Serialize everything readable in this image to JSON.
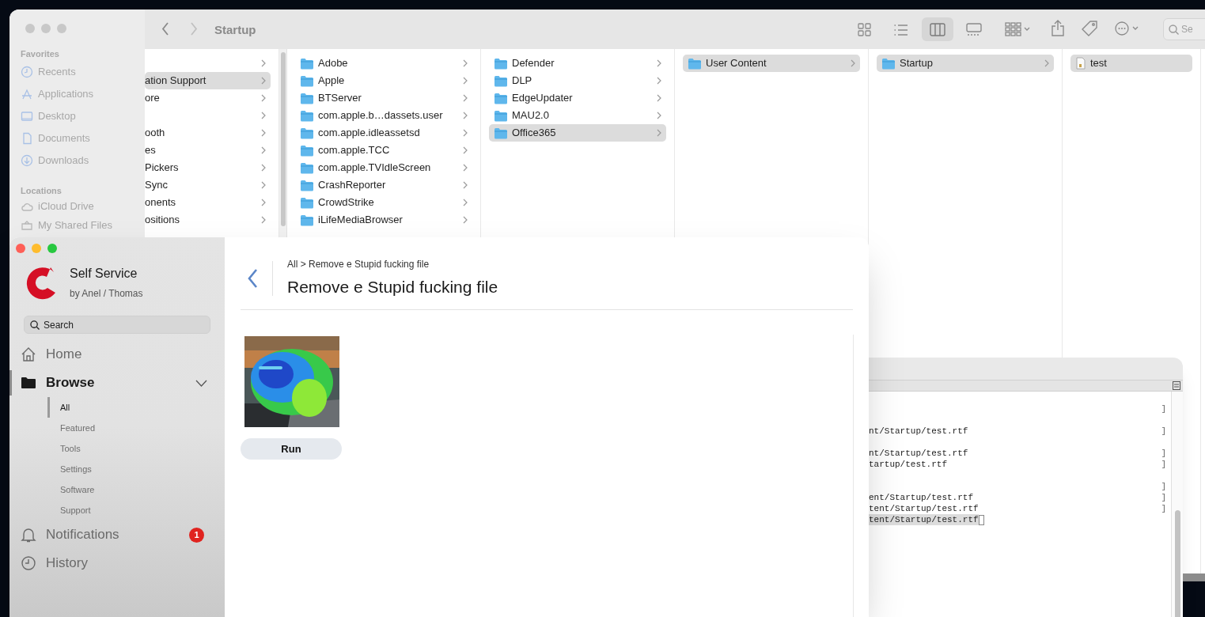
{
  "finder": {
    "title": "Startup",
    "search": {
      "placeholder": "Se"
    },
    "sidebar": [
      {
        "heading": "Favorites",
        "items": [
          {
            "label": "Recents"
          },
          {
            "label": "Applications"
          },
          {
            "label": "Desktop"
          },
          {
            "label": "Documents"
          },
          {
            "label": "Downloads"
          }
        ]
      },
      {
        "heading": "Locations",
        "items": [
          {
            "label": "iCloud Drive"
          },
          {
            "label": "My Shared Files"
          }
        ]
      }
    ],
    "view_modes": [
      {
        "kind": "icons",
        "selected": false
      },
      {
        "kind": "list",
        "selected": false
      },
      {
        "kind": "columns",
        "selected": true
      },
      {
        "kind": "gallery",
        "selected": false
      }
    ],
    "columns": [
      {
        "items": [
          {
            "kind": "plain",
            "selected": false,
            "expandable": true
          },
          {
            "name": "ation Support",
            "kind": "plain",
            "selected": true,
            "expandable": true
          },
          {
            "name": "ore",
            "kind": "plain",
            "selected": false,
            "expandable": true
          },
          {
            "kind": "plain",
            "selected": false,
            "expandable": true
          },
          {
            "name": "ooth",
            "kind": "plain",
            "selected": false,
            "expandable": true
          },
          {
            "name": "es",
            "kind": "plain",
            "selected": false,
            "expandable": true
          },
          {
            "name": "Pickers",
            "kind": "plain",
            "selected": false,
            "expandable": true
          },
          {
            "name": "Sync",
            "kind": "plain",
            "selected": false,
            "expandable": true
          },
          {
            "name": "onents",
            "kind": "plain",
            "selected": false,
            "expandable": true
          },
          {
            "name": "ositions",
            "kind": "plain",
            "selected": false,
            "expandable": true
          }
        ]
      },
      {
        "items": [
          {
            "name": "Adobe",
            "kind": "folder",
            "selected": false,
            "expandable": true
          },
          {
            "name": "Apple",
            "kind": "folder",
            "selected": false,
            "expandable": true
          },
          {
            "name": "BTServer",
            "kind": "folder",
            "selected": false,
            "expandable": true
          },
          {
            "name": "com.apple.b…dassets.user",
            "kind": "folder",
            "selected": false,
            "expandable": true
          },
          {
            "name": "com.apple.idleassetsd",
            "kind": "folder",
            "selected": false,
            "expandable": true
          },
          {
            "name": "com.apple.TCC",
            "kind": "folder",
            "selected": false,
            "expandable": true
          },
          {
            "name": "com.apple.TVIdleScreen",
            "kind": "folder",
            "selected": false,
            "expandable": true
          },
          {
            "name": "CrashReporter",
            "kind": "folder",
            "selected": false,
            "expandable": true
          },
          {
            "name": "CrowdStrike",
            "kind": "folder",
            "selected": false,
            "expandable": true
          },
          {
            "name": "iLifeMediaBrowser",
            "kind": "folder",
            "selected": false,
            "expandable": true
          }
        ]
      },
      {
        "items": [
          {
            "name": "Defender",
            "kind": "folder",
            "selected": false,
            "expandable": true
          },
          {
            "name": "DLP",
            "kind": "folder",
            "selected": false,
            "expandable": true
          },
          {
            "name": "EdgeUpdater",
            "kind": "folder",
            "selected": false,
            "expandable": true
          },
          {
            "name": "MAU2.0",
            "kind": "folder",
            "selected": false,
            "expandable": true
          },
          {
            "name": "Office365",
            "kind": "folder",
            "selected": true,
            "expandable": true
          }
        ]
      },
      {
        "items": [
          {
            "name": "User Content",
            "kind": "folder",
            "selected": true,
            "expandable": true
          }
        ]
      },
      {
        "items": [
          {
            "name": "Startup",
            "kind": "folder",
            "selected": true,
            "expandable": true
          }
        ]
      },
      {
        "items": [
          {
            "name": "test",
            "kind": "file",
            "selected": true,
            "expandable": false
          }
        ]
      }
    ]
  },
  "self_service": {
    "app_name": "Self Service",
    "subtitle": "by Anel / Thomas",
    "search": {
      "placeholder": "Search"
    },
    "nav": [
      {
        "label": "Home",
        "kind": "main",
        "selected": false
      },
      {
        "label": "Browse",
        "kind": "main",
        "selected": true,
        "expanded": true
      },
      {
        "label": "All",
        "kind": "sub",
        "selected": true
      },
      {
        "label": "Featured",
        "kind": "sub",
        "selected": false
      },
      {
        "label": "Tools",
        "kind": "sub",
        "selected": false
      },
      {
        "label": "Settings",
        "kind": "sub",
        "selected": false
      },
      {
        "label": "Software",
        "kind": "sub",
        "selected": false
      },
      {
        "label": "Support",
        "kind": "sub",
        "selected": false
      },
      {
        "label": "Notifications",
        "kind": "main",
        "selected": false,
        "badge": "1"
      },
      {
        "label": "History",
        "kind": "main",
        "selected": false
      }
    ],
    "breadcrumb": "All > Remove e Stupid fucking file",
    "title": "Remove e Stupid fucking file",
    "item": {
      "kind": "picture",
      "button": "Run"
    }
  },
  "terminal": {
    "blocks": [
      {
        "lines": [
          {
            "bracket": "]",
            "cursor": false
          }
        ]
      },
      {
        "lines": [
          {
            "text": "nt/Startup/test.rtf",
            "bracket": "]",
            "cursor": false
          }
        ]
      },
      {
        "lines": [
          {
            "text": "nt/Startup/test.rtf",
            "bracket": "]",
            "cursor": false
          },
          {
            "text": "tartup/test.rtf",
            "bracket": "]",
            "cursor": false
          }
        ]
      },
      {
        "lines": [
          {
            "bracket": "]",
            "cursor": false
          },
          {
            "text": "ent/Startup/test.rtf",
            "bracket": "]",
            "cursor": false
          },
          {
            "text": "tent/Startup/test.rtf",
            "bracket": "]",
            "cursor": false
          },
          {
            "text": "tent/Startup/test.rtf",
            "cursor": true
          }
        ]
      }
    ]
  }
}
